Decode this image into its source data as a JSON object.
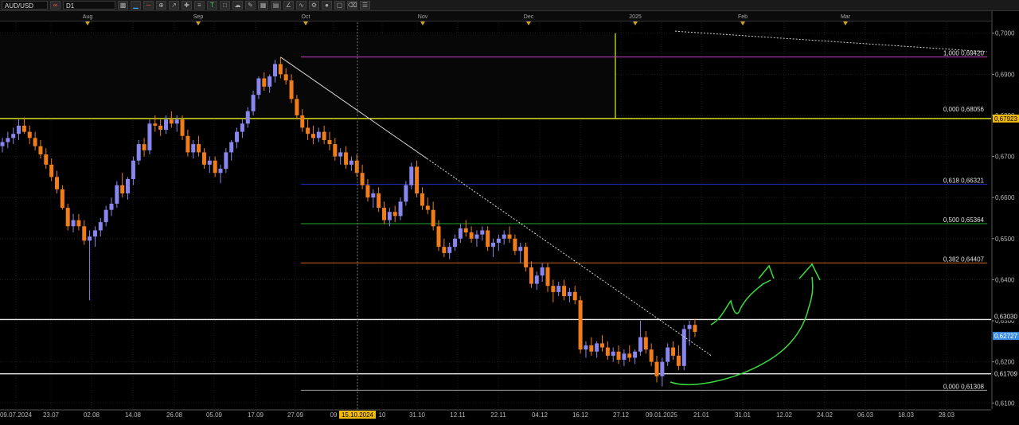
{
  "toolbar": {
    "symbol": "AUD/USD",
    "timeframe": "D1",
    "tools": [
      "chain-link-icon",
      "bar-chart-icon",
      "line-icon",
      "zoom-in-icon",
      "zoom-out-icon",
      "pointer-icon",
      "crosshair-icon",
      "text-tool-icon",
      "new-order-icon",
      "cloud-icon",
      "pencil-icon",
      "grid-icon",
      "table-icon",
      "fan-icon",
      "curve-icon",
      "settings-icon",
      "circle-icon",
      "template-icon",
      "eraser-icon",
      "align-icon",
      "panel-icon"
    ]
  },
  "colors": {
    "background": "#000000",
    "grid": "#202020",
    "bull_candle": "#8a86f0",
    "bear_candle": "#f07d1a",
    "price_label_current": "#3d8ee8",
    "price_label_yellow": "#f0b90b",
    "drawing_green": "#37e03a",
    "fib_0618": "#2030c8",
    "fib_0500": "#1fa82c",
    "fib_0382": "#c86418",
    "fib_1000": "#c040c0",
    "yellow_line": "#e8f020",
    "white_line": "#e8e8e8"
  },
  "chart_data": {
    "type": "candlestick",
    "symbol": "AUD/USD",
    "timeframe": "D1",
    "ylim": [
      0.6085,
      0.7015
    ],
    "y_ticks": [
      "0,7000",
      "0,6900",
      "0,6800",
      "0,6700",
      "0,6600",
      "0,6500",
      "0,6400",
      "0,6300",
      "0,6200",
      "0,6100"
    ],
    "x_date_labels": [
      "09.07.2024",
      "23.07",
      "02.08",
      "14.08",
      "26.08",
      "05.09",
      "17.09",
      "27.09",
      "09",
      "15.10.2024",
      "10",
      "31.10",
      "12.11",
      "22.11",
      "04.12",
      "16.12",
      "27.12",
      "09.01.2025",
      "21.01",
      "31.01",
      "12.02",
      "24.02",
      "06.03",
      "18.03",
      "28.03"
    ],
    "month_markers": [
      "Aug",
      "Sep",
      "Oct",
      "Nov",
      "Dec",
      "2025",
      "Feb",
      "Mar"
    ],
    "price_labels": [
      {
        "text": "0,67923",
        "value": 0.67923,
        "style": "yellow"
      },
      {
        "text": "0,63030",
        "value": 0.6303,
        "style": "plain"
      },
      {
        "text": "0,62727",
        "value": 0.62727,
        "style": "current"
      },
      {
        "text": "0,61709",
        "value": 0.61709,
        "style": "plain"
      }
    ],
    "horizontal_lines": [
      {
        "value": 0.67923,
        "color": "yellow"
      },
      {
        "value": 0.6303,
        "color": "white"
      },
      {
        "value": 0.61709,
        "color": "white"
      }
    ],
    "fib_levels": [
      {
        "label": "1,000 0,69420",
        "value": 0.6942,
        "color": "fib_1000"
      },
      {
        "label": "0,000 0,68056",
        "value": 0.68056,
        "color": "plain"
      },
      {
        "label": "0,618 0,66321",
        "value": 0.66321,
        "color": "fib_0618"
      },
      {
        "label": "0,500 0,65364",
        "value": 0.65364,
        "color": "fib_0500"
      },
      {
        "label": "0,382 0,64407",
        "value": 0.64407,
        "color": "fib_0382"
      },
      {
        "label": "0,000 0,61308",
        "value": 0.61308,
        "color": "plain"
      }
    ],
    "candles": [
      [
        0.6725,
        0.6745,
        0.671,
        0.6735
      ],
      [
        0.6735,
        0.676,
        0.672,
        0.6745
      ],
      [
        0.6745,
        0.677,
        0.673,
        0.6755
      ],
      [
        0.6755,
        0.679,
        0.674,
        0.6775
      ],
      [
        0.6775,
        0.6795,
        0.6755,
        0.676
      ],
      [
        0.676,
        0.6775,
        0.673,
        0.6745
      ],
      [
        0.6745,
        0.676,
        0.6715,
        0.6725
      ],
      [
        0.6725,
        0.674,
        0.6695,
        0.6705
      ],
      [
        0.6705,
        0.672,
        0.667,
        0.668
      ],
      [
        0.668,
        0.6695,
        0.664,
        0.665
      ],
      [
        0.665,
        0.6665,
        0.661,
        0.662
      ],
      [
        0.662,
        0.663,
        0.657,
        0.6575
      ],
      [
        0.6575,
        0.6585,
        0.652,
        0.653
      ],
      [
        0.653,
        0.656,
        0.6515,
        0.6545
      ],
      [
        0.6545,
        0.656,
        0.652,
        0.653
      ],
      [
        0.653,
        0.6545,
        0.6485,
        0.6495
      ],
      [
        0.6495,
        0.652,
        0.635,
        0.6505
      ],
      [
        0.6505,
        0.653,
        0.648,
        0.652
      ],
      [
        0.652,
        0.655,
        0.6505,
        0.654
      ],
      [
        0.654,
        0.658,
        0.653,
        0.657
      ],
      [
        0.657,
        0.66,
        0.6555,
        0.6585
      ],
      [
        0.6585,
        0.664,
        0.6575,
        0.663
      ],
      [
        0.663,
        0.666,
        0.66,
        0.661
      ],
      [
        0.661,
        0.665,
        0.6595,
        0.6645
      ],
      [
        0.6645,
        0.67,
        0.663,
        0.669
      ],
      [
        0.669,
        0.674,
        0.668,
        0.673
      ],
      [
        0.673,
        0.6745,
        0.67,
        0.6715
      ],
      [
        0.6715,
        0.679,
        0.6705,
        0.678
      ],
      [
        0.678,
        0.68,
        0.676,
        0.6775
      ],
      [
        0.6775,
        0.679,
        0.675,
        0.6765
      ],
      [
        0.6765,
        0.68,
        0.6755,
        0.679
      ],
      [
        0.679,
        0.681,
        0.677,
        0.678
      ],
      [
        0.678,
        0.68,
        0.676,
        0.679
      ],
      [
        0.679,
        0.68,
        0.674,
        0.675
      ],
      [
        0.675,
        0.6765,
        0.67,
        0.671
      ],
      [
        0.671,
        0.674,
        0.6695,
        0.673
      ],
      [
        0.673,
        0.675,
        0.67,
        0.671
      ],
      [
        0.671,
        0.672,
        0.667,
        0.668
      ],
      [
        0.668,
        0.67,
        0.666,
        0.669
      ],
      [
        0.669,
        0.67,
        0.665,
        0.666
      ],
      [
        0.666,
        0.668,
        0.6635,
        0.667
      ],
      [
        0.667,
        0.672,
        0.666,
        0.671
      ],
      [
        0.671,
        0.674,
        0.669,
        0.6735
      ],
      [
        0.6735,
        0.677,
        0.672,
        0.676
      ],
      [
        0.676,
        0.679,
        0.6745,
        0.678
      ],
      [
        0.678,
        0.682,
        0.677,
        0.681
      ],
      [
        0.681,
        0.686,
        0.68,
        0.685
      ],
      [
        0.685,
        0.6895,
        0.684,
        0.689
      ],
      [
        0.689,
        0.6905,
        0.686,
        0.687
      ],
      [
        0.687,
        0.69,
        0.6855,
        0.6895
      ],
      [
        0.6895,
        0.6935,
        0.688,
        0.6925
      ],
      [
        0.6925,
        0.6942,
        0.689,
        0.69
      ],
      [
        0.69,
        0.6915,
        0.6875,
        0.6885
      ],
      [
        0.6885,
        0.69,
        0.683,
        0.684
      ],
      [
        0.684,
        0.685,
        0.679,
        0.68
      ],
      [
        0.68,
        0.6815,
        0.676,
        0.677
      ],
      [
        0.677,
        0.679,
        0.674,
        0.6755
      ],
      [
        0.6755,
        0.6775,
        0.673,
        0.6745
      ],
      [
        0.6745,
        0.677,
        0.6735,
        0.676
      ],
      [
        0.676,
        0.6775,
        0.673,
        0.674
      ],
      [
        0.674,
        0.676,
        0.6715,
        0.673
      ],
      [
        0.673,
        0.6745,
        0.669,
        0.67
      ],
      [
        0.67,
        0.672,
        0.668,
        0.671
      ],
      [
        0.671,
        0.6725,
        0.667,
        0.668
      ],
      [
        0.668,
        0.67,
        0.6665,
        0.669
      ],
      [
        0.669,
        0.6705,
        0.665,
        0.666
      ],
      [
        0.666,
        0.668,
        0.662,
        0.663
      ],
      [
        0.663,
        0.6645,
        0.659,
        0.66
      ],
      [
        0.66,
        0.662,
        0.6575,
        0.661
      ],
      [
        0.661,
        0.6625,
        0.6565,
        0.6575
      ],
      [
        0.6575,
        0.659,
        0.6535,
        0.6545
      ],
      [
        0.6545,
        0.6575,
        0.653,
        0.6565
      ],
      [
        0.6565,
        0.658,
        0.654,
        0.6555
      ],
      [
        0.6555,
        0.66,
        0.6545,
        0.659
      ],
      [
        0.659,
        0.664,
        0.658,
        0.663
      ],
      [
        0.663,
        0.6685,
        0.662,
        0.6675
      ],
      [
        0.6675,
        0.669,
        0.66,
        0.661
      ],
      [
        0.661,
        0.6625,
        0.657,
        0.658
      ],
      [
        0.658,
        0.66,
        0.656,
        0.657
      ],
      [
        0.657,
        0.659,
        0.652,
        0.653
      ],
      [
        0.653,
        0.6545,
        0.647,
        0.648
      ],
      [
        0.648,
        0.65,
        0.6455,
        0.6465
      ],
      [
        0.6465,
        0.649,
        0.645,
        0.648
      ],
      [
        0.648,
        0.651,
        0.647,
        0.65
      ],
      [
        0.65,
        0.6535,
        0.649,
        0.6525
      ],
      [
        0.6525,
        0.6545,
        0.6505,
        0.6515
      ],
      [
        0.6515,
        0.653,
        0.649,
        0.65
      ],
      [
        0.65,
        0.652,
        0.648,
        0.651
      ],
      [
        0.651,
        0.653,
        0.6495,
        0.652
      ],
      [
        0.652,
        0.653,
        0.647,
        0.648
      ],
      [
        0.648,
        0.65,
        0.6455,
        0.649
      ],
      [
        0.649,
        0.651,
        0.647,
        0.65
      ],
      [
        0.65,
        0.652,
        0.6485,
        0.651
      ],
      [
        0.651,
        0.653,
        0.649,
        0.65
      ],
      [
        0.65,
        0.651,
        0.646,
        0.647
      ],
      [
        0.647,
        0.649,
        0.644,
        0.648
      ],
      [
        0.648,
        0.649,
        0.642,
        0.643
      ],
      [
        0.643,
        0.6445,
        0.638,
        0.639
      ],
      [
        0.639,
        0.642,
        0.6375,
        0.641
      ],
      [
        0.641,
        0.644,
        0.6395,
        0.643
      ],
      [
        0.643,
        0.644,
        0.637,
        0.6385
      ],
      [
        0.6385,
        0.64,
        0.6345,
        0.637
      ],
      [
        0.637,
        0.6395,
        0.636,
        0.6385
      ],
      [
        0.6385,
        0.64,
        0.635,
        0.636
      ],
      [
        0.636,
        0.638,
        0.6345,
        0.637
      ],
      [
        0.637,
        0.6385,
        0.634,
        0.635
      ],
      [
        0.635,
        0.636,
        0.622,
        0.623
      ],
      [
        0.623,
        0.625,
        0.621,
        0.624
      ],
      [
        0.624,
        0.626,
        0.6215,
        0.6225
      ],
      [
        0.6225,
        0.625,
        0.621,
        0.6245
      ],
      [
        0.6245,
        0.6265,
        0.6225,
        0.6235
      ],
      [
        0.6235,
        0.625,
        0.6205,
        0.6215
      ],
      [
        0.6215,
        0.6235,
        0.62,
        0.6225
      ],
      [
        0.6225,
        0.624,
        0.6195,
        0.6205
      ],
      [
        0.6205,
        0.623,
        0.619,
        0.622
      ],
      [
        0.622,
        0.624,
        0.62,
        0.621
      ],
      [
        0.621,
        0.623,
        0.6195,
        0.6225
      ],
      [
        0.6225,
        0.63,
        0.6215,
        0.626
      ],
      [
        0.626,
        0.6275,
        0.622,
        0.623
      ],
      [
        0.623,
        0.6245,
        0.619,
        0.62
      ],
      [
        0.62,
        0.6215,
        0.615,
        0.6165
      ],
      [
        0.6165,
        0.621,
        0.614,
        0.62
      ],
      [
        0.62,
        0.6245,
        0.619,
        0.6235
      ],
      [
        0.6235,
        0.625,
        0.6205,
        0.6215
      ],
      [
        0.6215,
        0.624,
        0.618,
        0.619
      ],
      [
        0.619,
        0.629,
        0.618,
        0.628
      ],
      [
        0.628,
        0.63,
        0.624,
        0.629
      ],
      [
        0.629,
        0.6305,
        0.626,
        0.6273
      ]
    ],
    "trendlines": [
      {
        "from_index": 51,
        "from_value": 0.6942,
        "to_index": 130,
        "to_value": 0.6215,
        "style": "solid-then-dotted"
      },
      {
        "from_index": 118,
        "from_value": 0.7005,
        "to_index": 160,
        "to_value": 0.6955,
        "style": "dotted"
      }
    ]
  }
}
